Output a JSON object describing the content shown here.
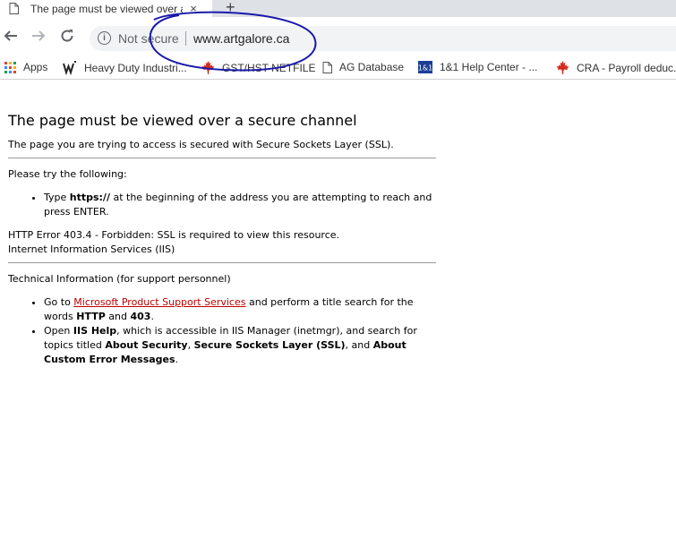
{
  "browser": {
    "tab_title": "The page must be viewed over a secure channel",
    "new_tab_symbol": "+",
    "close_symbol": "×",
    "security_text": "Not secure",
    "url": "www.artgalore.ca",
    "bookmarks": [
      {
        "label": "Apps",
        "icon": "apps-grid-icon"
      },
      {
        "label": "Heavy Duty Industri...",
        "icon": "gw-logo-icon"
      },
      {
        "label": "GST/HST NETFILE",
        "icon": "maple-leaf-icon"
      },
      {
        "label": "AG Database",
        "icon": "document-icon"
      },
      {
        "label": "1&1 Help Center - ...",
        "icon": "1and1-logo-icon"
      },
      {
        "label": "CRA - Payroll deduc...",
        "icon": "maple-leaf-icon"
      }
    ],
    "annotation_color": "#1a1aaa"
  },
  "page": {
    "heading": "The page must be viewed over a secure channel",
    "intro": "The page you are trying to access is secured with Secure Sockets Layer (SSL).",
    "try_label": "Please try the following:",
    "try_item": {
      "t1": "Type ",
      "b1": "https://",
      "t2": " at the beginning of the address you are attempting to reach and press ENTER."
    },
    "error_line": "HTTP Error 403.4 - Forbidden: SSL is required to view this resource.",
    "server_line": "Internet Information Services (IIS)",
    "tech_label": "Technical Information (for support personnel)",
    "tech_item1": {
      "t1": "Go to ",
      "link": "Microsoft Product Support Services",
      "t2": " and perform a title search for the words ",
      "b1": "HTTP",
      "t3": " and ",
      "b2": "403",
      "t4": "."
    },
    "tech_item2": {
      "t1": "Open ",
      "b1": "IIS Help",
      "t2": ", which is accessible in IIS Manager (inetmgr), and search for topics titled ",
      "b2": "About Security",
      "t3": ", ",
      "b3": "Secure Sockets Layer (SSL)",
      "t4": ", and ",
      "b4": "About Custom Error Messages",
      "t5": "."
    }
  }
}
